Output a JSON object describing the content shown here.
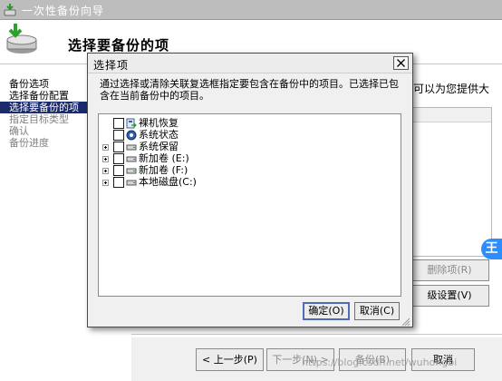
{
  "wizard": {
    "title": "一次性备份向导",
    "header_title": "选择要备份的项",
    "steps": [
      {
        "label": "备份选项",
        "state": "done"
      },
      {
        "label": "选择备份配置",
        "state": "done"
      },
      {
        "label": "选择要备份的项",
        "state": "current"
      },
      {
        "label": "指定目标类型",
        "state": "future"
      },
      {
        "label": "确认",
        "state": "future"
      },
      {
        "label": "备份进度",
        "state": "future"
      }
    ],
    "description_visible_fragment": "可以为您提供大",
    "buttons": {
      "remove": "删除项(R)",
      "advanced": "级设置(V)",
      "prev": "< 上一步(P)",
      "next": "下一步(N) >",
      "backup": "备份(B)",
      "cancel": "取消"
    }
  },
  "dialog": {
    "title": "选择项",
    "instruction": "通过选择或清除关联复选框指定要包含在备份中的项目。已选择已包含在当前备份中的项目。",
    "tree": [
      {
        "label": "裸机恢复",
        "expandable": false,
        "checked": false,
        "icon": "bare-metal-recovery-icon"
      },
      {
        "label": "系统状态",
        "expandable": false,
        "checked": false,
        "icon": "system-state-icon"
      },
      {
        "label": "系统保留",
        "expandable": true,
        "checked": false,
        "icon": "drive-icon"
      },
      {
        "label": "新加卷 (E:)",
        "expandable": true,
        "checked": false,
        "icon": "drive-icon"
      },
      {
        "label": "新加卷 (F:)",
        "expandable": true,
        "checked": false,
        "icon": "drive-icon"
      },
      {
        "label": "本地磁盘(C:)",
        "expandable": true,
        "checked": false,
        "icon": "drive-icon"
      }
    ],
    "ok_label": "确定(O)",
    "cancel_label": "取消(C)"
  },
  "overlay": {
    "watermark": "https://blog.csdn.net/wuhongbi",
    "badge_text": "王"
  },
  "colors": {
    "title_bar": "#bdbdbd",
    "selected_step": "#1b2a6b",
    "disabled_text": "#808080",
    "badge": "#2c8dff"
  }
}
